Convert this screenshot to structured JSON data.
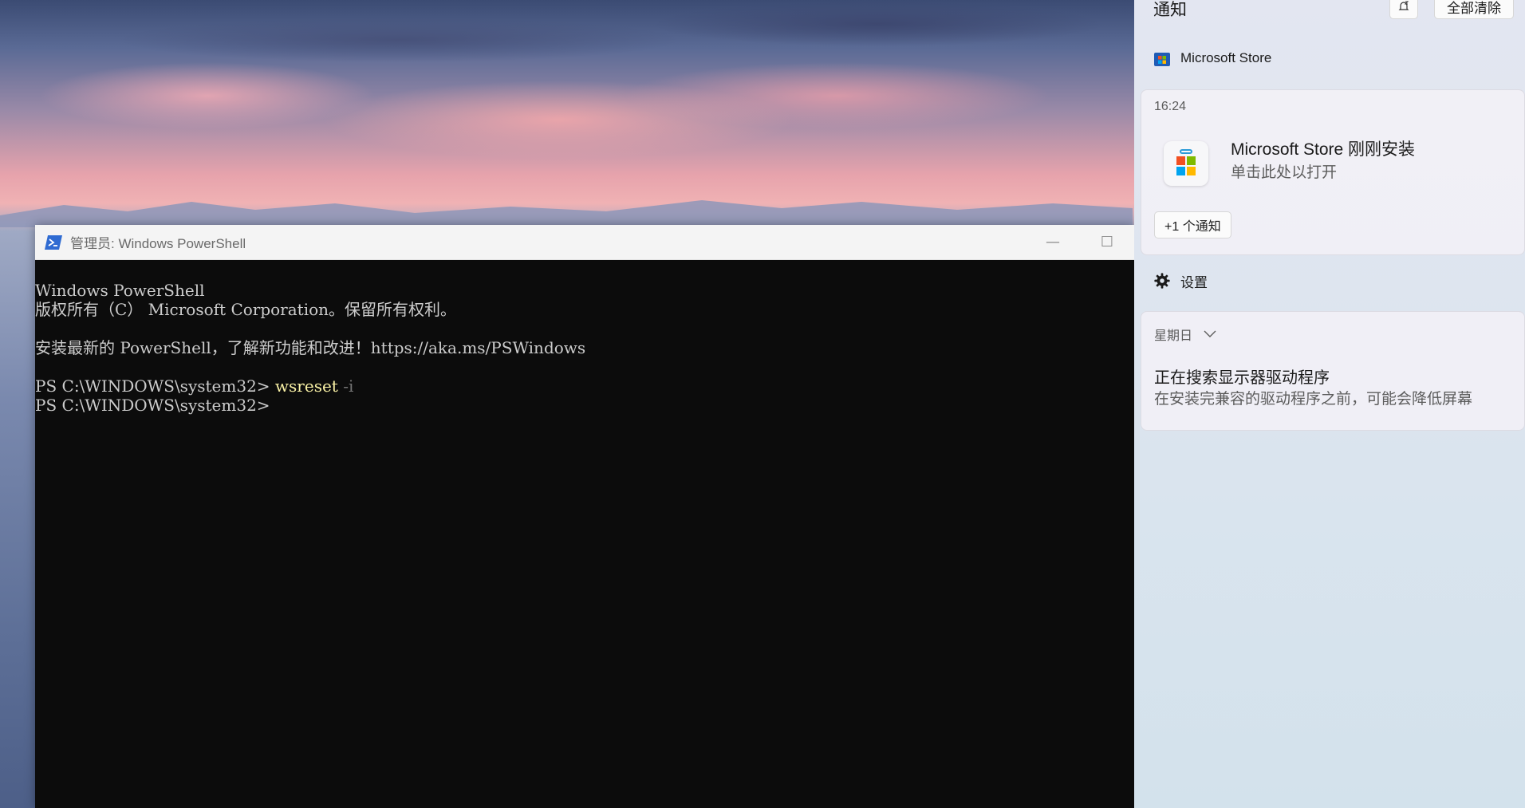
{
  "terminal": {
    "title": "管理员: Windows PowerShell",
    "lines": {
      "l1": "Windows PowerShell",
      "l2": "版权所有（C） Microsoft Corporation。保留所有权利。",
      "l3": "安装最新的 PowerShell，了解新功能和改进！https://aka.ms/PSWindows",
      "prompt1": "PS C:\\WINDOWS\\system32> ",
      "cmd1": "wsreset",
      "param1": " -i",
      "prompt2": "PS C:\\WINDOWS\\system32> "
    },
    "controls": {
      "minimize": "—",
      "maximize": "☐"
    }
  },
  "notifications": {
    "title": "通知",
    "clear_all": "全部清除",
    "groups": [
      {
        "app_name": "Microsoft Store",
        "time": "16:24",
        "title": "Microsoft Store 刚刚安装",
        "subtitle": "单击此处以打开",
        "more": "+1 个通知"
      },
      {
        "app_name": "设置",
        "day": "星期日",
        "title": "正在搜索显示器驱动程序",
        "subtitle": "在安装完兼容的驱动程序之前，可能会降低屏幕"
      }
    ]
  },
  "colors": {
    "terminal_bg": "#0c0c0c",
    "terminal_fg": "#cccccc",
    "command": "#f9f1a5",
    "parameter": "#767676",
    "ps_blue": "#2f6bd2",
    "ms_red": "#f25022",
    "ms_green": "#7fba00",
    "ms_blue": "#00a4ef",
    "ms_yellow": "#ffb900"
  },
  "icons": [
    "powershell-icon",
    "dnd-bell-icon",
    "microsoft-store-icon",
    "gear-icon",
    "chevron-down-icon"
  ]
}
